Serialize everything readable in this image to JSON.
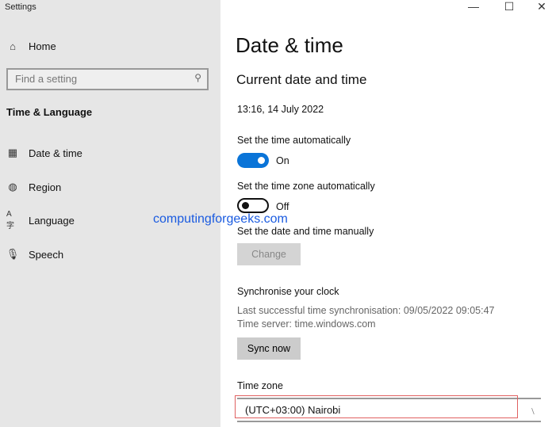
{
  "window": {
    "title": "Settings",
    "minimize_icon": "minimize-icon",
    "maximize_icon": "maximize-icon",
    "close_icon": "close-icon"
  },
  "sidebar": {
    "home": "Home",
    "search_placeholder": "Find a setting",
    "section": "Time & Language",
    "items": [
      {
        "label": "Date & time",
        "icon": "calendar-clock-icon"
      },
      {
        "label": "Region",
        "icon": "globe-icon"
      },
      {
        "label": "Language",
        "icon": "language-icon"
      },
      {
        "label": "Speech",
        "icon": "microphone-icon"
      }
    ]
  },
  "main": {
    "title": "Date & time",
    "subtitle": "Current date and time",
    "current": "13:16, 14 July 2022",
    "auto_time_label": "Set the time automatically",
    "auto_time_state": "On",
    "auto_zone_label": "Set the time zone automatically",
    "auto_zone_state": "Off",
    "manual_label": "Set the date and time manually",
    "change_button": "Change",
    "sync_title": "Synchronise your clock",
    "last_sync": "Last successful time synchronisation: 09/05/2022 09:05:47",
    "time_server": "Time server: time.windows.com",
    "sync_button": "Sync now",
    "timezone_label": "Time zone",
    "timezone_value": "(UTC+03:00) Nairobi"
  },
  "watermark": "computingforgeeks.com",
  "colors": {
    "accent": "#0a74d8",
    "highlight": "#e06060"
  }
}
